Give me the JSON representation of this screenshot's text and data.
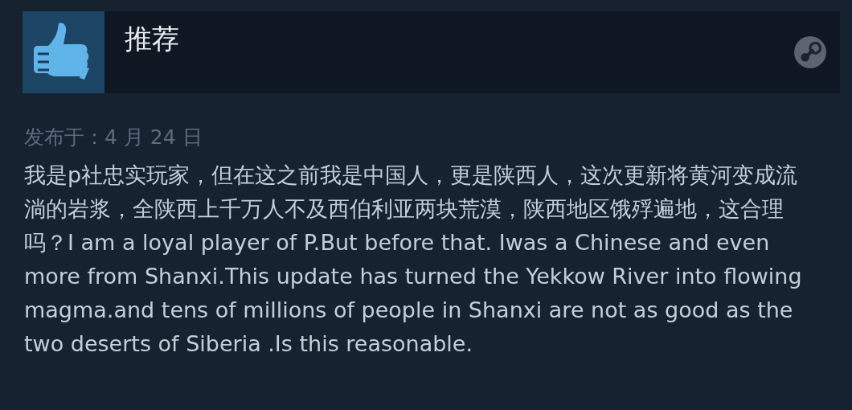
{
  "review": {
    "verdict": "推荐",
    "recommended": true,
    "posted": "发布于：4 月 24 日",
    "text": "我是p社忠实玩家，但在这之前我是中国人，更是陕西人，这次更新将黄河变成流淌的岩浆，全陕西上千万人不及西伯利亚两块荒漠，陕西地区饿殍遍地，这合理吗？I am a loyal player of P.But before that. Iwas a Chinese and even more from Shanxi.This update has turned the Yekkow River into flowing magma.and tens of millions of people in Shanxi are not as good as the two deserts of Siberia .Is this reasonable."
  }
}
